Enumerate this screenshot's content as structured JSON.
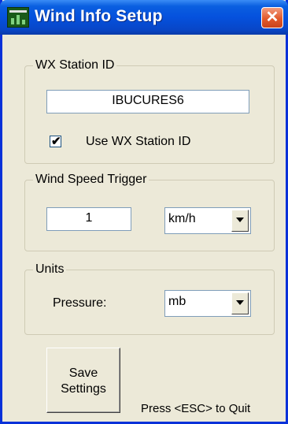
{
  "window": {
    "title": "Wind Info Setup",
    "close_glyph": "✕"
  },
  "wx_station": {
    "legend": "WX Station ID",
    "station_id": "IBUCURES6",
    "use_id_checked": true,
    "use_id_label": "Use WX Station ID"
  },
  "wind_trigger": {
    "legend": "Wind Speed Trigger",
    "value": "1",
    "unit": "km/h"
  },
  "units": {
    "legend": "Units",
    "pressure_label": "Pressure:",
    "pressure_unit": "mb"
  },
  "footer": {
    "save_label_line1": "Save",
    "save_label_line2": "Settings",
    "quit_hint": "Press <ESC> to Quit"
  },
  "colors": {
    "title_bar": "#0551dd",
    "close_button": "#e25a2b",
    "dialog_bg": "#ece9d8"
  }
}
